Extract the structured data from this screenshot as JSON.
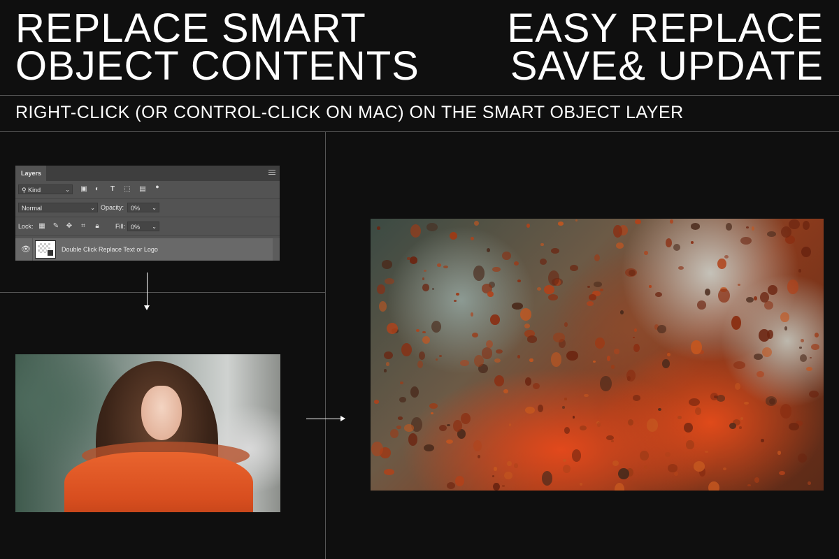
{
  "header": {
    "left_title": [
      "REPLACE SMART",
      "OBJECT CONTENTS"
    ],
    "right_title": [
      "EASY REPLACE",
      "SAVE& UPDATE"
    ]
  },
  "instruction": "RIGHT-CLICK (OR CONTROL-CLICK ON MAC) ON THE SMART OBJECT LAYER",
  "layers_panel": {
    "tab_label": "Layers",
    "filter_kind": "Kind",
    "blend_mode": "Normal",
    "opacity_label": "Opacity:",
    "opacity_value": "0%",
    "lock_label": "Lock:",
    "fill_label": "Fill:",
    "fill_value": "0%",
    "layer_name": "Double Click Replace Text or Logo",
    "icons": [
      "search-icon",
      "image-filter-icon",
      "adjustment-filter-icon",
      "type-filter-icon",
      "shape-filter-icon",
      "smart-object-filter-icon",
      "filter-toggle-icon",
      "lock-transparent-icon",
      "lock-brush-icon",
      "lock-move-icon",
      "lock-artboard-icon",
      "lock-all-icon",
      "eye-icon",
      "panel-menu-icon"
    ]
  },
  "colors": {
    "background": "#0f0f0f",
    "divider": "#555555",
    "panel": "#535353",
    "accent_orange": "#e2491c"
  }
}
